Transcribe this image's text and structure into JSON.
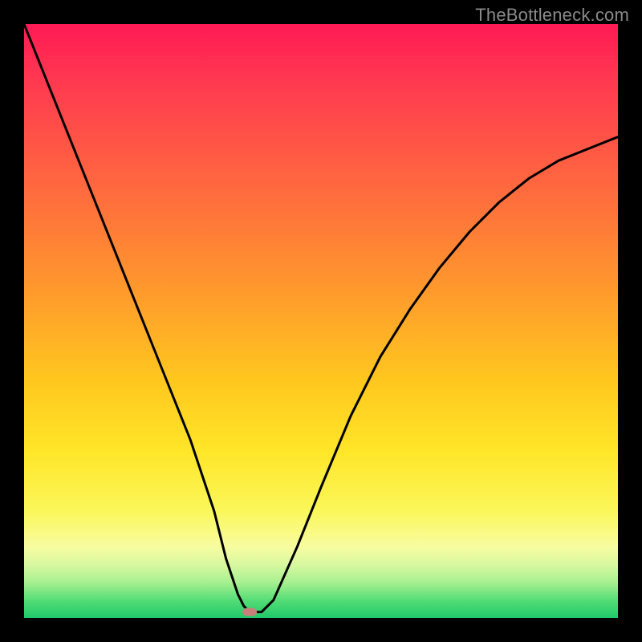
{
  "watermark": {
    "text": "TheBottleneck.com"
  },
  "chart_data": {
    "type": "line",
    "title": "",
    "xlabel": "",
    "ylabel": "",
    "xlim": [
      0,
      100
    ],
    "ylim": [
      0,
      100
    ],
    "grid": false,
    "legend": false,
    "marker": {
      "x": 38,
      "y": 1,
      "color": "#c8807a",
      "shape": "pill"
    },
    "series": [
      {
        "name": "bottleneck-curve",
        "color": "#000000",
        "x": [
          0,
          4,
          8,
          12,
          16,
          20,
          24,
          28,
          32,
          34,
          36,
          37,
          38,
          39,
          40,
          42,
          46,
          50,
          55,
          60,
          65,
          70,
          75,
          80,
          85,
          90,
          95,
          100
        ],
        "y": [
          100,
          90,
          80,
          70,
          60,
          50,
          40,
          30,
          18,
          10,
          4,
          2,
          1,
          1,
          1,
          3,
          12,
          22,
          34,
          44,
          52,
          59,
          65,
          70,
          74,
          77,
          79,
          81
        ]
      }
    ],
    "background_gradient_stops": [
      {
        "pos": 0.0,
        "color": "#ff1a55"
      },
      {
        "pos": 0.1,
        "color": "#ff3a50"
      },
      {
        "pos": 0.28,
        "color": "#ff6a3e"
      },
      {
        "pos": 0.45,
        "color": "#ff9a2c"
      },
      {
        "pos": 0.6,
        "color": "#ffc71e"
      },
      {
        "pos": 0.72,
        "color": "#ffe628"
      },
      {
        "pos": 0.82,
        "color": "#faf75a"
      },
      {
        "pos": 0.88,
        "color": "#f8fca0"
      },
      {
        "pos": 0.91,
        "color": "#d8f8a0"
      },
      {
        "pos": 0.94,
        "color": "#a8f090"
      },
      {
        "pos": 0.97,
        "color": "#55dd77"
      },
      {
        "pos": 1.0,
        "color": "#1fc86a"
      }
    ]
  }
}
